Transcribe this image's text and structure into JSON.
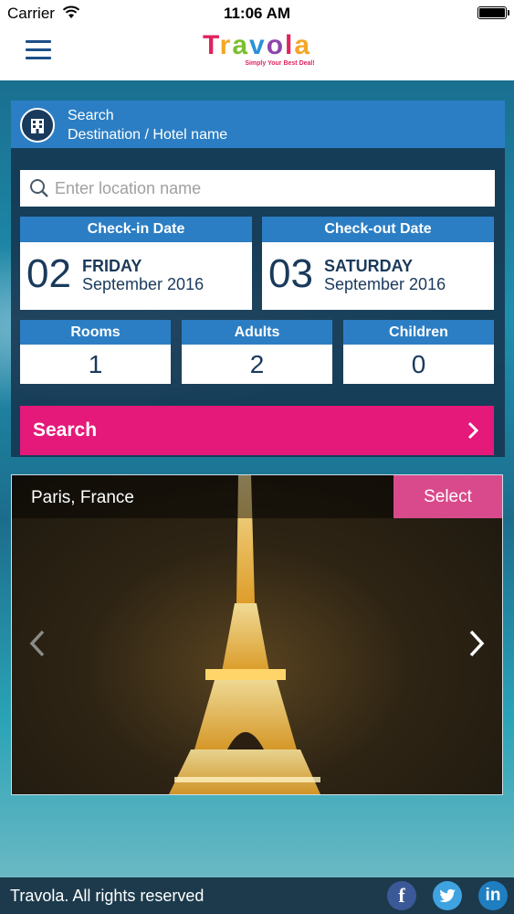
{
  "status_bar": {
    "carrier": "Carrier",
    "time": "11:06 AM"
  },
  "header": {
    "logo": "Travola",
    "tagline": "Simply Your Best Deal!"
  },
  "search_panel": {
    "title": "Search",
    "subtitle": "Destination / Hotel name",
    "location_placeholder": "Enter location name",
    "checkin": {
      "label": "Check-in Date",
      "day": "02",
      "weekday": "FRIDAY",
      "month_year": "September 2016"
    },
    "checkout": {
      "label": "Check-out Date",
      "day": "03",
      "weekday": "SATURDAY",
      "month_year": "September 2016"
    },
    "rooms": {
      "label": "Rooms",
      "value": "1"
    },
    "adults": {
      "label": "Adults",
      "value": "2"
    },
    "children": {
      "label": "Children",
      "value": "0"
    },
    "search_button": "Search"
  },
  "carousel": {
    "title": "Paris, France",
    "select_button": "Select"
  },
  "footer": {
    "text": "Travola. All rights reserved",
    "facebook": "f",
    "linkedin": "in"
  },
  "colors": {
    "brand_blue": "#2c7ec4",
    "accent_pink": "#e5197a",
    "select_pink": "#d94a8c"
  }
}
